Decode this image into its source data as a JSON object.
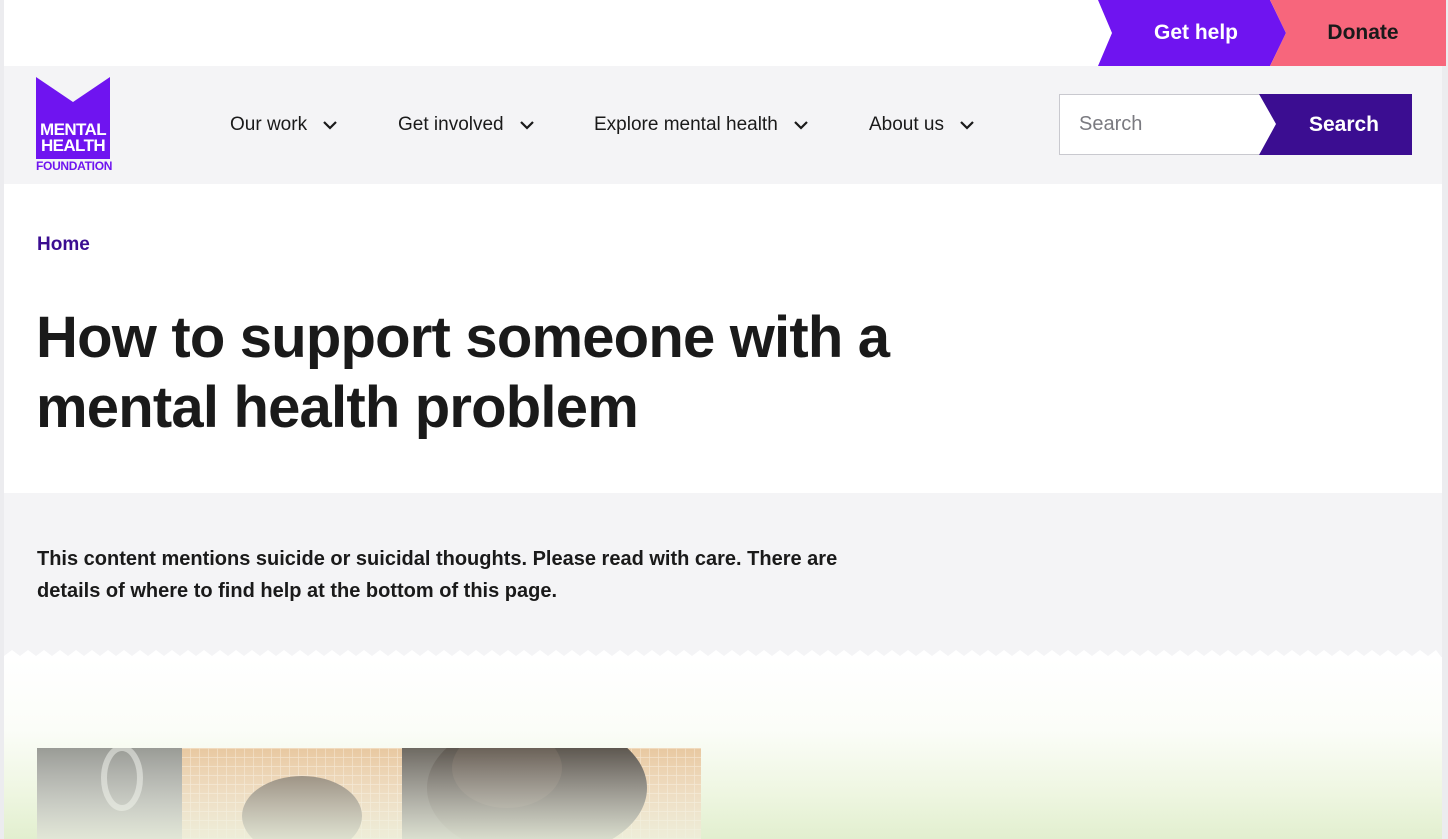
{
  "utility": {
    "get_help_label": "Get help",
    "donate_label": "Donate"
  },
  "logo": {
    "line1": "MENTAL",
    "line2": "HEALTH",
    "line3": "FOUNDATION"
  },
  "nav": {
    "items": [
      {
        "label": "Our work"
      },
      {
        "label": "Get involved"
      },
      {
        "label": "Explore mental health"
      },
      {
        "label": "About us"
      }
    ]
  },
  "search": {
    "placeholder": "Search",
    "button_label": "Search"
  },
  "breadcrumb": {
    "home_label": "Home"
  },
  "page": {
    "title": "How to support someone with a mental health problem",
    "content_warning": "This content mentions suicide or suicidal thoughts. Please read with care. There are details of where to find help at the bottom of this page."
  },
  "colors": {
    "brand_purple": "#6f14f0",
    "dark_purple": "#3b0d91",
    "donate_pink": "#f7667c",
    "header_bg": "#f4f4f6"
  },
  "icons": {
    "nav_chevron": "chevron-down-icon",
    "logo_mark": "mental-health-foundation-logo"
  }
}
